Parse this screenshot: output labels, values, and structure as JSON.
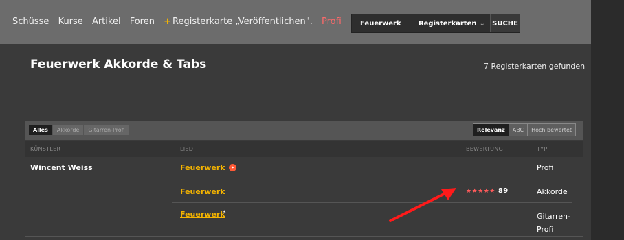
{
  "nav": {
    "items": [
      "Schüsse",
      "Kurse",
      "Artikel",
      "Foren"
    ],
    "publish_star": "+",
    "publish_label": "Registerkarte „Veröffentlichen\".",
    "pro_label": "Profi"
  },
  "search": {
    "query": "Feuerwerk",
    "type_label": "Registerkarten",
    "button_label": "SUCHE"
  },
  "page": {
    "title": "Feuerwerk Akkorde & Tabs",
    "results_count": "7 Registerkarten gefunden"
  },
  "filters": {
    "tabs": [
      {
        "label": "Alles",
        "active": true
      },
      {
        "label": "Akkorde",
        "active": false
      },
      {
        "label": "Gitarren-Profi",
        "active": false
      }
    ],
    "sort": [
      {
        "label": "Relevanz",
        "active": true
      },
      {
        "label": "ABC",
        "active": false
      },
      {
        "label": "Hoch bewertet",
        "active": false
      }
    ]
  },
  "table": {
    "headers": {
      "artist": "KÜNSTLER",
      "song": "LIED",
      "rating": "BEWERTUNG",
      "type": "TYP"
    },
    "rows": [
      {
        "artist": "Wincent Weiss",
        "song": "Feuerwerk",
        "has_play": true,
        "rating_stars": "",
        "rating_count": "",
        "type": "Profi"
      },
      {
        "artist": "",
        "song": "Feuerwerk",
        "has_play": false,
        "rating_stars": "★★★★★",
        "rating_count": "89",
        "type": "Akkorde"
      },
      {
        "artist": "",
        "song": "Feuerwerk",
        "has_play": false,
        "asterisk": "*",
        "rating_stars": "",
        "rating_count": "",
        "type_line1": "Gitarren-",
        "type_line2": "Profi"
      }
    ]
  },
  "colors": {
    "accent_link": "#f5b400",
    "pro": "#ff6a6a",
    "annotation_arrow": "#ff1a1a"
  }
}
